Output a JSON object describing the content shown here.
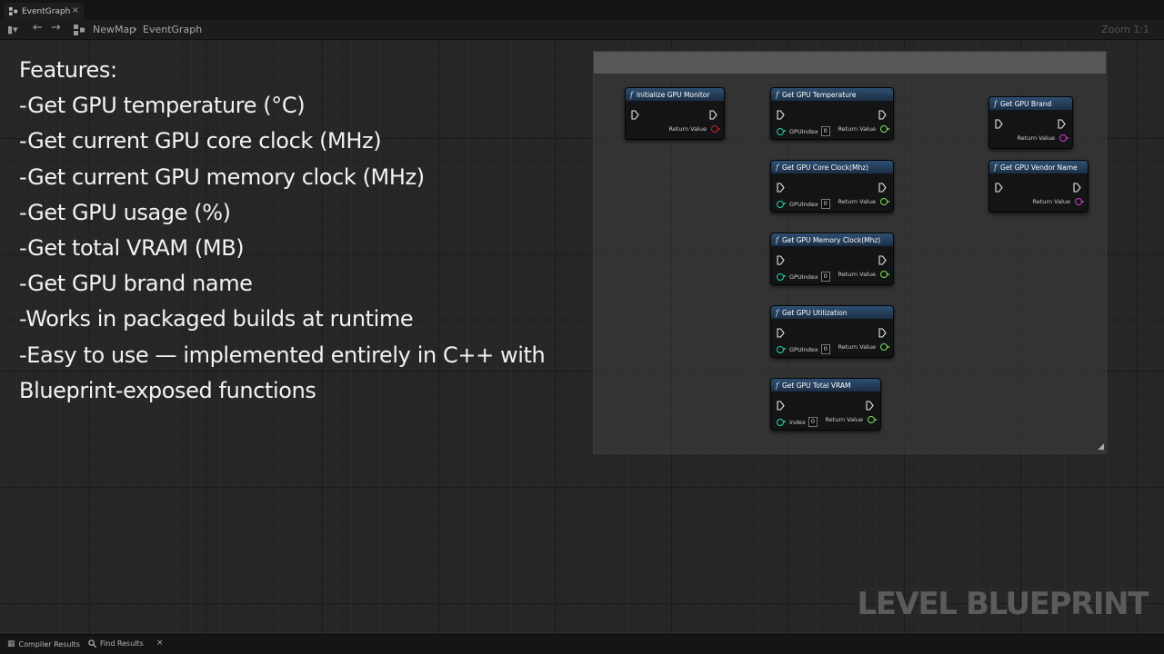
{
  "tab": {
    "label": "EventGraph",
    "close": "×"
  },
  "toolbar": {
    "breadcrumb": [
      "NewMap",
      "EventGraph"
    ],
    "breadcrumb_separator": "›",
    "zoom": "Zoom 1:1"
  },
  "features": [
    "Features:",
    "-Get GPU temperature (°C)",
    "-Get current GPU core clock (MHz)",
    "-Get current GPU memory clock (MHz)",
    "-Get GPU usage (%)",
    "-Get total VRAM (MB)",
    "-Get GPU brand name",
    "-Works in packaged builds at runtime",
    "-Easy to use — implemented entirely in C++ with",
    "Blueprint-exposed functions"
  ],
  "nodes": [
    {
      "title": "Initialize GPU Monitor",
      "input_label": "",
      "input_value": "",
      "output_label": "Return Value",
      "output_color": "red"
    },
    {
      "title": "Get GPU Temperature",
      "input_label": "GPUIndex",
      "input_value": "0",
      "output_label": "Return Value",
      "output_color": "green"
    },
    {
      "title": "Get GPU Core Clock(Mhz)",
      "input_label": "GPUIndex",
      "input_value": "0",
      "output_label": "Return Value",
      "output_color": "green"
    },
    {
      "title": "Get GPU Memory Clock(Mhz)",
      "input_label": "GPUIndex",
      "input_value": "0",
      "output_label": "Return Value",
      "output_color": "green"
    },
    {
      "title": "Get GPU Utilization",
      "input_label": "GPUIndex",
      "input_value": "0",
      "output_label": "Return Value",
      "output_color": "green"
    },
    {
      "title": "Get GPU Total VRAM",
      "input_label": "Index",
      "input_value": "0",
      "output_label": "Return Value",
      "output_color": "green"
    },
    {
      "title": "Get GPU Brand",
      "input_label": "",
      "input_value": "",
      "output_label": "Return Value",
      "output_color": "pink"
    },
    {
      "title": "Get GPU Vendor Name",
      "input_label": "",
      "input_value": "",
      "output_label": "Return Value",
      "output_color": "pink"
    }
  ],
  "node_icon": "function-icon",
  "watermark": "LEVEL BLUEPRINT",
  "bottom_tabs": [
    {
      "label": "Compiler Results",
      "icon": "compiler-icon"
    },
    {
      "label": "Find Results",
      "icon": "search-icon",
      "close": "×"
    }
  ],
  "colors": {
    "node_header": "#2e4f72",
    "pin_red": "#c0252a",
    "pin_green": "#7de055",
    "pin_teal": "#2fd1a6",
    "pin_pink": "#d83ac6"
  }
}
